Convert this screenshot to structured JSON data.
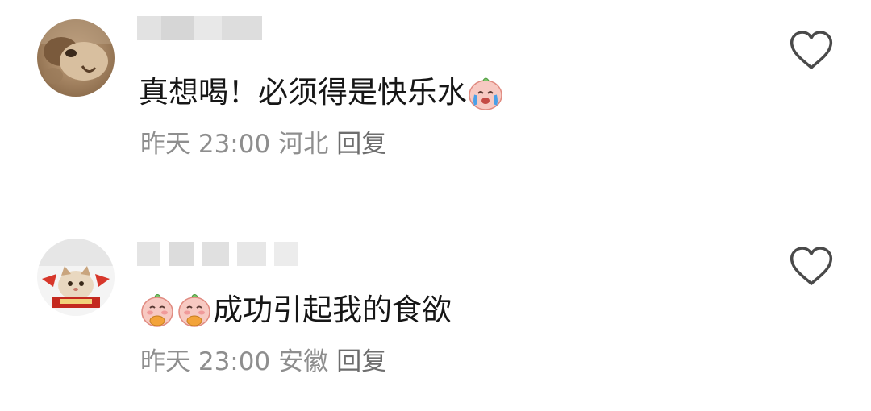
{
  "comments": [
    {
      "comment_text": "真想喝！必须得是快乐水",
      "time": "昨天 23:00",
      "location": "河北",
      "reply_label": "回复",
      "emojis": [
        "crying-peach-emoji"
      ],
      "avatar_icon": "bear-avatar"
    },
    {
      "comment_text": "成功引起我的食欲",
      "time": "昨天 23:00",
      "location": "安徽",
      "reply_label": "回复",
      "emojis": [
        "peach-eating-emoji",
        "peach-eating-emoji"
      ],
      "avatar_icon": "cat-avatar"
    }
  ],
  "colors": {
    "text_primary": "#161616",
    "text_secondary": "#8e8e8e",
    "icon_stroke": "#4a4a4a"
  },
  "icons": [
    "heart-outline-icon",
    "crying-peach-emoji",
    "peach-eating-emoji",
    "bear-avatar",
    "cat-avatar"
  ]
}
